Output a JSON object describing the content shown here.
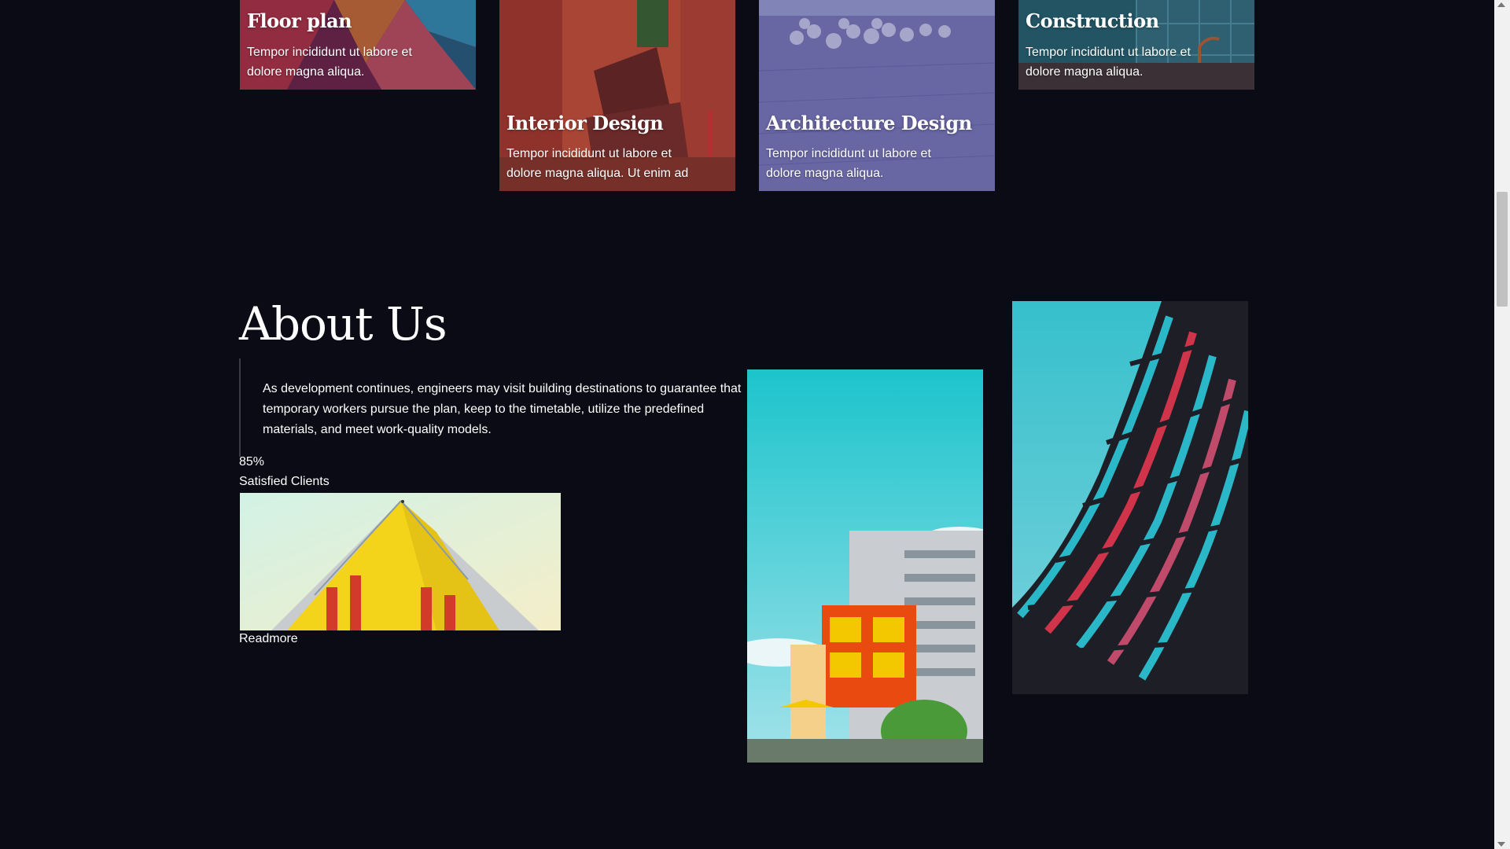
{
  "services": [
    {
      "title": "Floor plan",
      "desc": "Tempor incididunt ut labore et dolore magna aliqua."
    },
    {
      "title": "Interior Design",
      "desc": "Tempor incididunt ut labore et dolore magna aliqua. Ut enim ad"
    },
    {
      "title": "Architecture Design",
      "desc": "Tempor incididunt ut labore et dolore magna aliqua."
    },
    {
      "title": "Construction",
      "desc": "Tempor incididunt ut labore et dolore magna aliqua."
    }
  ],
  "about": {
    "title": "About Us",
    "text": "As development continues, engineers may visit building destinations to guarantee that temporary workers pursue the plan, keep to the timetable, utilize the predefined materials, and meet work-quality models.",
    "stat_value": "85%",
    "stat_label": "Satisfied Clients",
    "readmore": "Readmore"
  },
  "colors": {
    "background": "#0a0b14",
    "text": "#ffffff"
  }
}
